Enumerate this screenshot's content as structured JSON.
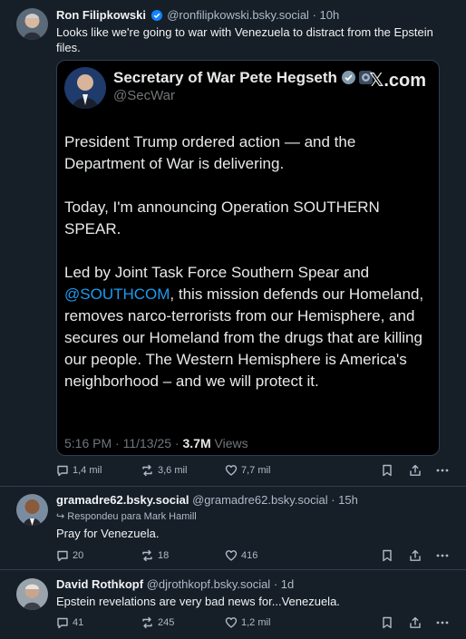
{
  "colors": {
    "background": "#161e27",
    "accent": "#1185fe",
    "mention": "#1d9bf0",
    "muted": "#aebbc9"
  },
  "posts": [
    {
      "name": "Ron Filipkowski",
      "handle": "@ronfilipkowski.bsky.social",
      "time": "· 10h",
      "verified": true,
      "text": "Looks like we're going to war with Venezuela to distract from the Epstein files.",
      "embed": {
        "display_name": "Secretary of War Pete Hegseth",
        "handle": "@SecWar",
        "brand": "𝕏.com",
        "paragraphs": [
          "President Trump ordered action — and the Department of War is delivering.",
          "Today, I'm announcing Operation SOUTHERN SPEAR."
        ],
        "p3_before": "Led by Joint Task Force Southern Spear and ",
        "p3_mention": "@SOUTHCOM",
        "p3_after": ", this mission defends our Homeland, removes narco-terrorists from our Hemisphere, and secures our Homeland from the drugs that are killing our people. The Western Hemisphere is America's neighborhood – and we will protect it.",
        "timestamp": "5:16 PM · 11/13/25 · ",
        "views_count": "3.7M",
        "views_label": "Views"
      },
      "replies": "1,4 mil",
      "reposts": "3,6 mil",
      "likes": "7,7 mil"
    },
    {
      "name": "gramadre62.bsky.social",
      "handle": "@gramadre62.bsky.social",
      "time": "· 15h",
      "reply_to": "Respondeu para Mark Hamill",
      "text": "Pray for Venezuela.",
      "replies": "20",
      "reposts": "18",
      "likes": "416"
    },
    {
      "name": "David Rothkopf",
      "handle": "@djrothkopf.bsky.social",
      "time": "· 1d",
      "text": "Epstein revelations are very bad news for...Venezuela.",
      "replies": "41",
      "reposts": "245",
      "likes": "1,2 mil"
    }
  ]
}
